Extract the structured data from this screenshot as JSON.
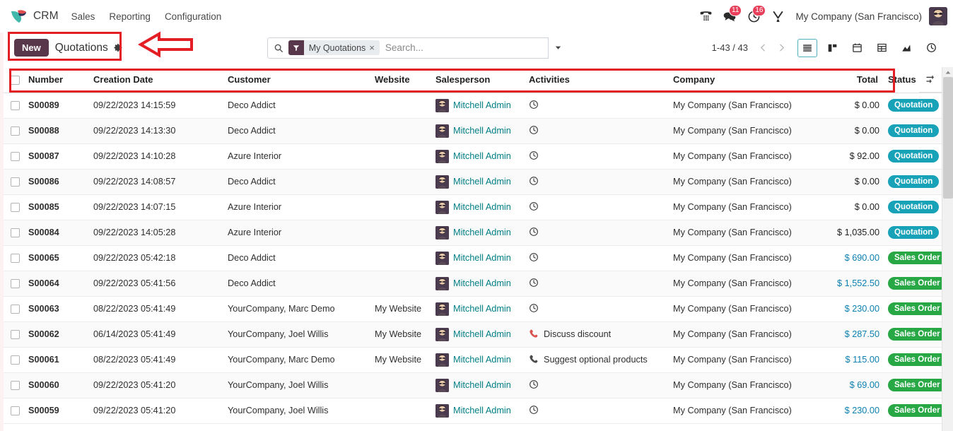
{
  "app": {
    "brand": "CRM",
    "logo_icon": "odoo-logo-icon",
    "menus": [
      "Sales",
      "Reporting",
      "Configuration"
    ],
    "systray": {
      "voip_icon": "phone-dialpad-icon",
      "messages_icon": "chat-bubble-icon",
      "messages_count": "11",
      "activities_icon": "clock-icon",
      "activities_count": "16",
      "tools_icon": "wrench-tools-icon",
      "company": "My Company (San Francisco)",
      "avatar_icon": "user-avatar"
    }
  },
  "control_panel": {
    "new_label": "New",
    "breadcrumb": "Quotations",
    "gear_icon": "gear-icon",
    "search": {
      "search_icon": "search-icon",
      "facet_icon": "filter-funnel-icon",
      "facet_label": "My Quotations",
      "facet_remove_icon": "close-x-icon",
      "placeholder": "Search...",
      "value": "",
      "caret_icon": "chevron-down-icon"
    },
    "pager": "1-43 / 43",
    "prev_icon": "chevron-left-icon",
    "next_icon": "chevron-right-icon",
    "views": [
      {
        "name": "list",
        "icon": "list-view-icon",
        "active": true
      },
      {
        "name": "kanban",
        "icon": "kanban-view-icon",
        "active": false
      },
      {
        "name": "calendar",
        "icon": "calendar-view-icon",
        "active": false
      },
      {
        "name": "pivot",
        "icon": "pivot-view-icon",
        "active": false
      },
      {
        "name": "graph",
        "icon": "graph-view-icon",
        "active": false
      },
      {
        "name": "activity",
        "icon": "activity-view-icon",
        "active": false
      }
    ]
  },
  "table": {
    "optional_columns_icon": "column-options-icon",
    "select_all_checkbox": false,
    "columns": [
      "Number",
      "Creation Date",
      "Customer",
      "Website",
      "Salesperson",
      "Activities",
      "Company",
      "Total",
      "Status"
    ],
    "rows": [
      {
        "number": "S00089",
        "date": "09/22/2023 14:15:59",
        "customer": "Deco Addict",
        "website": "",
        "salesperson": "Mitchell Admin",
        "activity_icon": "clock-icon",
        "activity": "",
        "company": "My Company (San Francisco)",
        "total": "$ 0.00",
        "total_style": "plain",
        "status": "Quotation",
        "status_color": "#17a2b8"
      },
      {
        "number": "S00088",
        "date": "09/22/2023 14:13:30",
        "customer": "Deco Addict",
        "website": "",
        "salesperson": "Mitchell Admin",
        "activity_icon": "clock-icon",
        "activity": "",
        "company": "My Company (San Francisco)",
        "total": "$ 0.00",
        "total_style": "plain",
        "status": "Quotation",
        "status_color": "#17a2b8"
      },
      {
        "number": "S00087",
        "date": "09/22/2023 14:10:28",
        "customer": "Azure Interior",
        "website": "",
        "salesperson": "Mitchell Admin",
        "activity_icon": "clock-icon",
        "activity": "",
        "company": "My Company (San Francisco)",
        "total": "$ 92.00",
        "total_style": "plain",
        "status": "Quotation",
        "status_color": "#17a2b8"
      },
      {
        "number": "S00086",
        "date": "09/22/2023 14:08:57",
        "customer": "Deco Addict",
        "website": "",
        "salesperson": "Mitchell Admin",
        "activity_icon": "clock-icon",
        "activity": "",
        "company": "My Company (San Francisco)",
        "total": "$ 0.00",
        "total_style": "plain",
        "status": "Quotation",
        "status_color": "#17a2b8"
      },
      {
        "number": "S00085",
        "date": "09/22/2023 14:07:15",
        "customer": "Azure Interior",
        "website": "",
        "salesperson": "Mitchell Admin",
        "activity_icon": "clock-icon",
        "activity": "",
        "company": "My Company (San Francisco)",
        "total": "$ 0.00",
        "total_style": "plain",
        "status": "Quotation",
        "status_color": "#17a2b8"
      },
      {
        "number": "S00084",
        "date": "09/22/2023 14:05:28",
        "customer": "Azure Interior",
        "website": "",
        "salesperson": "Mitchell Admin",
        "activity_icon": "clock-icon",
        "activity": "",
        "company": "My Company (San Francisco)",
        "total": "$ 1,035.00",
        "total_style": "plain",
        "status": "Quotation",
        "status_color": "#17a2b8"
      },
      {
        "number": "S00065",
        "date": "09/22/2023 05:42:18",
        "customer": "Deco Addict",
        "website": "",
        "salesperson": "Mitchell Admin",
        "activity_icon": "clock-icon",
        "activity": "",
        "company": "My Company (San Francisco)",
        "total": "$ 690.00",
        "total_style": "link",
        "status": "Sales Order",
        "status_color": "#28a745"
      },
      {
        "number": "S00064",
        "date": "09/22/2023 05:41:56",
        "customer": "Deco Addict",
        "website": "",
        "salesperson": "Mitchell Admin",
        "activity_icon": "clock-icon",
        "activity": "",
        "company": "My Company (San Francisco)",
        "total": "$ 1,552.50",
        "total_style": "link",
        "status": "Sales Order",
        "status_color": "#28a745"
      },
      {
        "number": "S00063",
        "date": "08/22/2023 05:41:49",
        "customer": "YourCompany, Marc Demo",
        "website": "My Website",
        "salesperson": "Mitchell Admin",
        "activity_icon": "clock-icon",
        "activity": "",
        "company": "My Company (San Francisco)",
        "total": "$ 230.00",
        "total_style": "link",
        "status": "Sales Order",
        "status_color": "#28a745"
      },
      {
        "number": "S00062",
        "date": "06/14/2023 05:41:49",
        "customer": "YourCompany, Joel Willis",
        "website": "My Website",
        "salesperson": "Mitchell Admin",
        "activity_icon": "phone-icon-overdue",
        "activity": "Discuss discount",
        "company": "My Company (San Francisco)",
        "total": "$ 287.50",
        "total_style": "link",
        "status": "Sales Order",
        "status_color": "#28a745"
      },
      {
        "number": "S00061",
        "date": "08/22/2023 05:41:49",
        "customer": "YourCompany, Marc Demo",
        "website": "My Website",
        "salesperson": "Mitchell Admin",
        "activity_icon": "phone-icon",
        "activity": "Suggest optional products",
        "company": "My Company (San Francisco)",
        "total": "$ 115.00",
        "total_style": "link",
        "status": "Sales Order",
        "status_color": "#28a745"
      },
      {
        "number": "S00060",
        "date": "09/22/2023 05:41:20",
        "customer": "YourCompany, Joel Willis",
        "website": "",
        "salesperson": "Mitchell Admin",
        "activity_icon": "clock-icon",
        "activity": "",
        "company": "My Company (San Francisco)",
        "total": "$ 69.00",
        "total_style": "link",
        "status": "Sales Order",
        "status_color": "#28a745"
      },
      {
        "number": "S00059",
        "date": "09/22/2023 05:41:20",
        "customer": "YourCompany, Joel Willis",
        "website": "",
        "salesperson": "Mitchell Admin",
        "activity_icon": "clock-icon",
        "activity": "",
        "company": "My Company (San Francisco)",
        "total": "$ 230.00",
        "total_style": "link",
        "status": "Sales Order",
        "status_color": "#28a745"
      }
    ]
  },
  "annotations": {
    "color": "#e31e24",
    "shapes": [
      "rect-around-new-button",
      "left-arrow",
      "rect-around-table-header"
    ]
  },
  "colors": {
    "brand_purple": "#59374b",
    "link_teal": "#017e84",
    "quotation_badge": "#17a2b8",
    "salesorder_badge": "#28a745",
    "badge_red": "#e8405a",
    "annotation_red": "#e31e24"
  }
}
